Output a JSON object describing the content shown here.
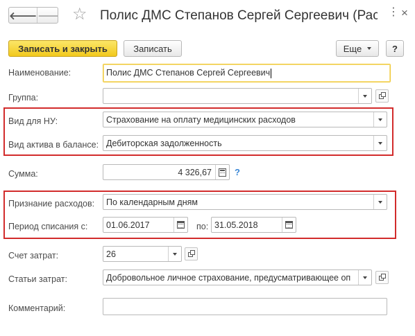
{
  "window": {
    "title": "Полис ДМС Степанов Сергей Сергеевич (Расх…",
    "nav_back": "🡐",
    "nav_forward": "🡒",
    "favorite_icon": "star-icon",
    "more_icon": "⋮",
    "close_icon": "×"
  },
  "toolbar": {
    "save_close_label": "Записать и закрыть",
    "save_label": "Записать",
    "more_label": "Еще",
    "help_label": "?"
  },
  "form": {
    "name": {
      "label": "Наименование:",
      "value": "Полис ДМС Степанов Сергей Сергеевич"
    },
    "group": {
      "label": "Группа:",
      "value": ""
    },
    "tax_type": {
      "label": "Вид для НУ:",
      "value": "Страхование на оплату медицинских расходов"
    },
    "asset_type": {
      "label": "Вид актива в балансе:",
      "value": "Дебиторская задолженность"
    },
    "amount": {
      "label": "Сумма:",
      "value": "4 326,67",
      "help": "?"
    },
    "recognition": {
      "label": "Признание расходов:",
      "value": "По календарным дням"
    },
    "period": {
      "label": "Период списания с:",
      "from": "01.06.2017",
      "to_label": "по:",
      "to": "31.05.2018"
    },
    "cost_account": {
      "label": "Счет затрат:",
      "value": "26"
    },
    "cost_items": {
      "label": "Статьи затрат:",
      "value": "Добровольное личное страхование, предусматривающее оп"
    },
    "comment": {
      "label": "Комментарий:",
      "value": ""
    }
  },
  "colors": {
    "primary_button": "#f2c91d",
    "highlight_border": "#d22b2b",
    "focus_border": "#f0c93a",
    "help_blue": "#3a87d6"
  }
}
